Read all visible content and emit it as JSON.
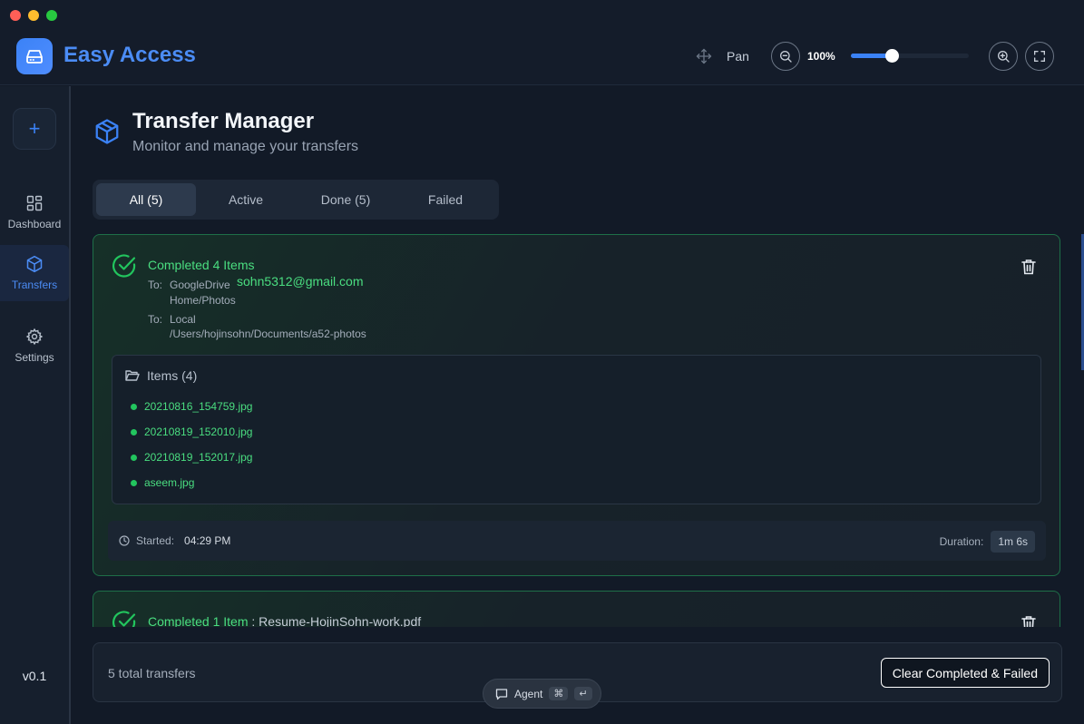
{
  "app": {
    "title": "Easy Access"
  },
  "toolbar": {
    "pan_label": "Pan",
    "zoom_value": "100%",
    "zoom_fraction": 0.35
  },
  "sidebar": {
    "add_label": "+",
    "items": [
      {
        "label": "Dashboard",
        "icon": "grid-icon",
        "active": false
      },
      {
        "label": "Transfers",
        "icon": "box-icon",
        "active": true
      },
      {
        "label": "Settings",
        "icon": "gear-icon",
        "active": false
      }
    ],
    "version": "v0.1"
  },
  "page": {
    "title": "Transfer Manager",
    "subtitle": "Monitor and manage your transfers"
  },
  "tabs": [
    {
      "label": "All (5)",
      "active": true
    },
    {
      "label": "Active",
      "active": false
    },
    {
      "label": "Done (5)",
      "active": false
    },
    {
      "label": "Failed",
      "active": false
    }
  ],
  "transfers": [
    {
      "title": "Completed 4 Items",
      "destinations": [
        {
          "label": "To:",
          "service": "GoogleDrive",
          "account": "sohn5312@gmail.com",
          "path": "Home/Photos"
        },
        {
          "label": "To:",
          "service": "Local",
          "path": "/Users/hojinsohn/Documents/a52-photos"
        }
      ],
      "items_header": "Items (4)",
      "items": [
        "20210816_154759.jpg",
        "20210819_152010.jpg",
        "20210819_152017.jpg",
        "aseem.jpg"
      ],
      "started_label": "Started:",
      "started_time": "04:29 PM",
      "duration_label": "Duration:",
      "duration": "1m 6s"
    },
    {
      "title": "Completed 1 Item",
      "separator": " : ",
      "file": "Resume-HojinSohn-work.pdf"
    }
  ],
  "footer": {
    "count_text": "5 total transfers",
    "clear_label": "Clear Completed & Failed"
  },
  "agent": {
    "label": "Agent",
    "key1": "⌘",
    "key2": "↵"
  },
  "colors": {
    "accent": "#3b82f6",
    "success": "#4ade80",
    "background": "#121a27"
  }
}
